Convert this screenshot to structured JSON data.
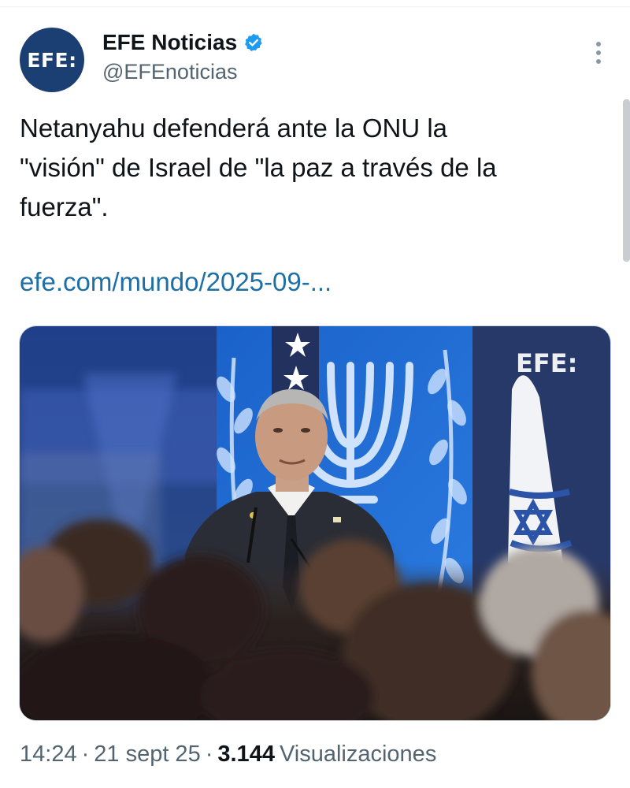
{
  "account": {
    "avatar_text": "EFE:",
    "display_name": "EFE Noticias",
    "handle": "@EFEnoticias",
    "verified_icon": "verified-badge-icon",
    "brand_color": "#1c3f73",
    "verified_color": "#1d9bf0"
  },
  "tweet": {
    "text": "Netanyahu defenderá ante la ONU la\n\"visión\" de Israel de \"la paz a través de la\nfuerza\".",
    "link": "efe.com/mundo/2025-09-...",
    "link_color": "#1d6fa5"
  },
  "media": {
    "watermark": "EFE:"
  },
  "meta": {
    "time": "14:24",
    "separator": "·",
    "date": "21 sept 25",
    "views_count": "3.144",
    "views_label": "Visualizaciones"
  }
}
